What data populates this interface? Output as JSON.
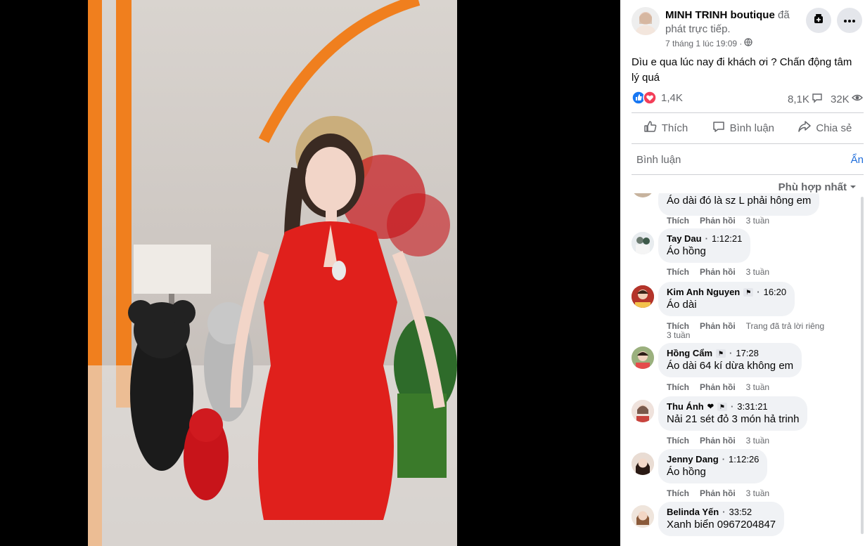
{
  "post": {
    "page_name": "MINH TRINH boutique",
    "action_text": "đã phát trực tiếp.",
    "timestamp": "7 tháng 1 lúc 19:09 ·",
    "caption": "Dìu e qua lúc nay đi khách ơi ? Chấn động tâm lý quá",
    "reaction_count": "1,4K",
    "comment_count": "8,1K",
    "view_count": "32K"
  },
  "actions": {
    "like": "Thích",
    "comment": "Bình luận",
    "share": "Chia sẻ"
  },
  "comment_input": {
    "placeholder": "Bình luận",
    "hide": "Ẩn"
  },
  "sort_label": "Phù hợp nhất",
  "meta_labels": {
    "like": "Thích",
    "reply": "Phản hồi"
  },
  "comments": [
    {
      "name": "",
      "time": "",
      "text": "Áo dài đó là sz L phải hông em",
      "age": "3 tuần"
    },
    {
      "name": "Tay Dau",
      "time": "1:12:21",
      "text": "Áo hồng",
      "age": "3 tuần"
    },
    {
      "name": "Kim Anh Nguyen",
      "time": "16:20",
      "text": "Áo dài",
      "note": "Trang đã trả lời riêng",
      "age": "3 tuần"
    },
    {
      "name": "Hồng Cẩm",
      "time": "17:28",
      "text": "Áo dài 64 kí dừa không em",
      "age": "3 tuần"
    },
    {
      "name": "Thu Ánh",
      "time": "3:31:21",
      "text": "Nải 21 sét đỏ 3 món hả trinh",
      "age": "3 tuần"
    },
    {
      "name": "Jenny Dang",
      "time": "1:12:26",
      "text": "Áo hồng",
      "age": "3 tuần"
    },
    {
      "name": "Belinda Yến",
      "time": "33:52",
      "text": "Xanh biển 0967204847",
      "age": ""
    }
  ],
  "colors": {
    "accent": "#216fdb",
    "bubble": "#f0f2f5",
    "muted": "#65676b",
    "dress": "#e0201c",
    "frame_orange": "#f07f1e"
  }
}
